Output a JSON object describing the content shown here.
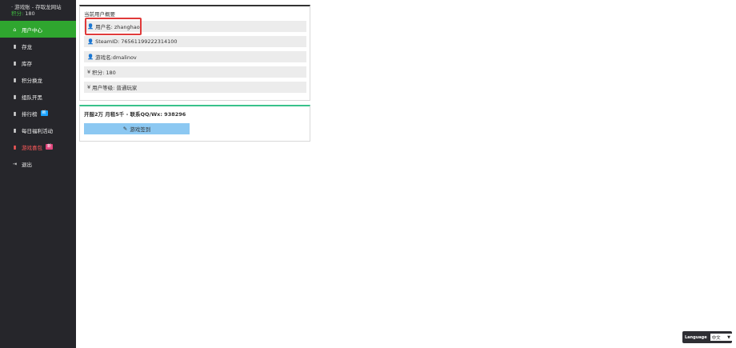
{
  "sidebar": {
    "brand_line": "· 游戏账 - 存取龙网站",
    "points_label": "积分:",
    "points_value": "180",
    "items": [
      {
        "label": "用户中心",
        "icon": "home-icon"
      },
      {
        "label": "存龙",
        "icon": "bar-chart-icon"
      },
      {
        "label": "库存",
        "icon": "bar-chart-icon"
      },
      {
        "label": "积分换龙",
        "icon": "bar-chart-icon"
      },
      {
        "label": "组队开黑",
        "icon": "bar-chart-icon"
      },
      {
        "label": "排行榜",
        "icon": "bar-chart-icon",
        "badge": "新"
      },
      {
        "label": "每日福利活动",
        "icon": "bar-chart-icon"
      },
      {
        "label": "游戏喜包",
        "icon": "bar-chart-icon",
        "badge": "新"
      },
      {
        "label": "退出",
        "icon": "logout-icon"
      }
    ]
  },
  "summary": {
    "title": "当前用户概要",
    "rows": [
      {
        "label": "用户名: zhanghao",
        "icon": "user-icon"
      },
      {
        "label": "SteamID: 76561199222314100",
        "icon": "user-icon"
      },
      {
        "label": "游戏名:dmalinov",
        "icon": "user-icon"
      },
      {
        "label": "积分: 180",
        "icon": "yen-icon"
      },
      {
        "label": "用户等级: 普通玩家",
        "icon": "yen-icon"
      }
    ]
  },
  "signin": {
    "title": "开服2万 月租5千 - 联系QQ/Wx: 938296",
    "button_label": "游戏签到"
  },
  "language": {
    "label": "Language",
    "selected": "中文"
  },
  "colors": {
    "sidebar_bg": "#26262b",
    "active_green": "#2fa62f",
    "highlight_red": "#e03a3a",
    "button_blue": "#8cc8f2"
  }
}
